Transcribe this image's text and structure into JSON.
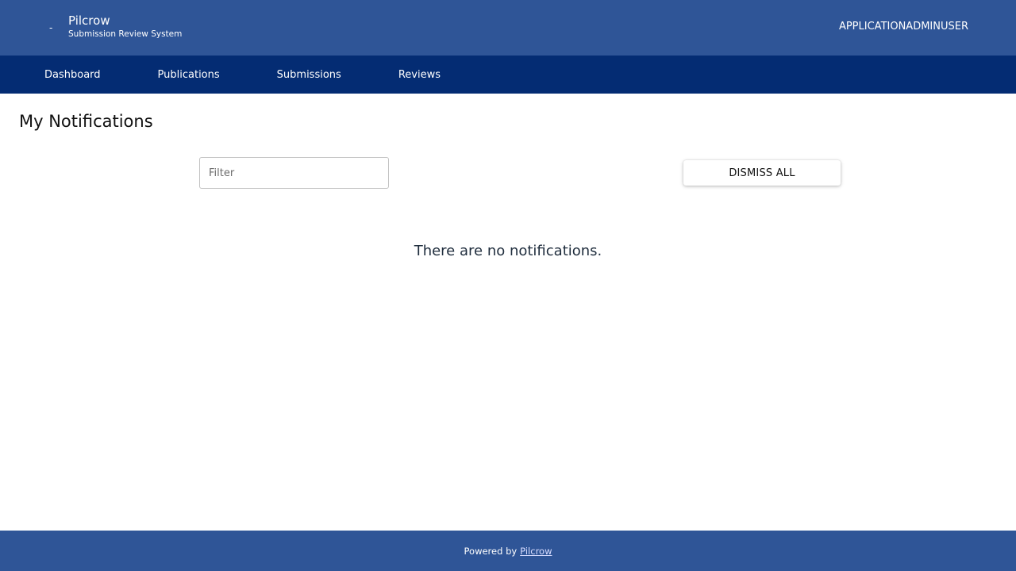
{
  "header": {
    "logo_mark": "-",
    "app_name": "Pilcrow",
    "app_subtitle": "Submission Review System",
    "user_name": "APPLICATIONADMINUSER"
  },
  "nav": {
    "items": [
      {
        "label": "Dashboard"
      },
      {
        "label": "Publications"
      },
      {
        "label": "Submissions"
      },
      {
        "label": "Reviews"
      }
    ]
  },
  "main": {
    "title": "My Notifications",
    "filter": {
      "placeholder": "Filter",
      "value": ""
    },
    "dismiss_all_label": "DISMISS ALL",
    "empty_message": "There are no notifications."
  },
  "footer": {
    "powered_by": "Powered by",
    "link_label": "Pilcrow"
  },
  "colors": {
    "header_bg": "#2f5597",
    "nav_bg": "#042c73",
    "footer_bg": "#2f5597",
    "text_dark": "#1f2d3d"
  }
}
